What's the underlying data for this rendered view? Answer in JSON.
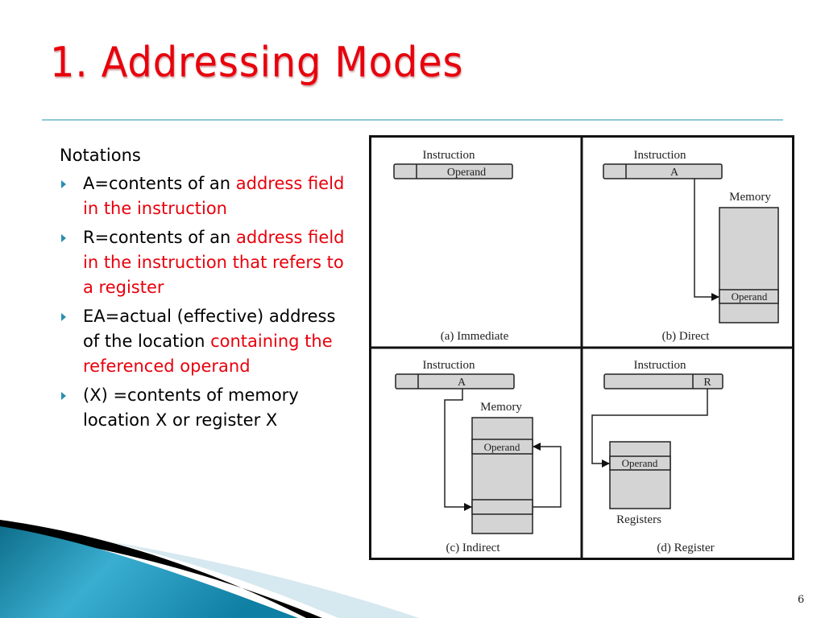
{
  "slide": {
    "title": "1. Addressing Modes",
    "page_number": "6",
    "colors": {
      "title": "#e8000c",
      "highlight": "#e8000c",
      "bullet": "#2a8fb0",
      "rule": "#8ec9d2"
    }
  },
  "notations": {
    "heading": "Notations",
    "items": [
      {
        "term": "A",
        "rest": "=contents of an",
        "red": "address field in the instruction",
        "after": ""
      },
      {
        "term": "R",
        "rest": "=contents of an",
        "red": "address field in the instruction that refers to a register",
        "after": ""
      },
      {
        "term": "EA",
        "rest": "=actual (effective) address of the location",
        "red": "containing the referenced operand",
        "after": ""
      },
      {
        "term": "(X)",
        "rest": " =contents of memory location X or register X",
        "red": "",
        "after": ""
      }
    ]
  },
  "figure": {
    "panels": [
      {
        "id": "a",
        "caption": "(a) Immediate",
        "instruction_label": "Instruction",
        "field": "Operand"
      },
      {
        "id": "b",
        "caption": "(b) Direct",
        "instruction_label": "Instruction",
        "field": "A",
        "memory_label": "Memory",
        "cell": "Operand"
      },
      {
        "id": "c",
        "caption": "(c) Indirect",
        "instruction_label": "Instruction",
        "field": "A",
        "memory_label": "Memory",
        "cell": "Operand"
      },
      {
        "id": "d",
        "caption": "(d) Register",
        "instruction_label": "Instruction",
        "field": "R",
        "registers_label": "Registers",
        "cell": "Operand"
      }
    ]
  }
}
